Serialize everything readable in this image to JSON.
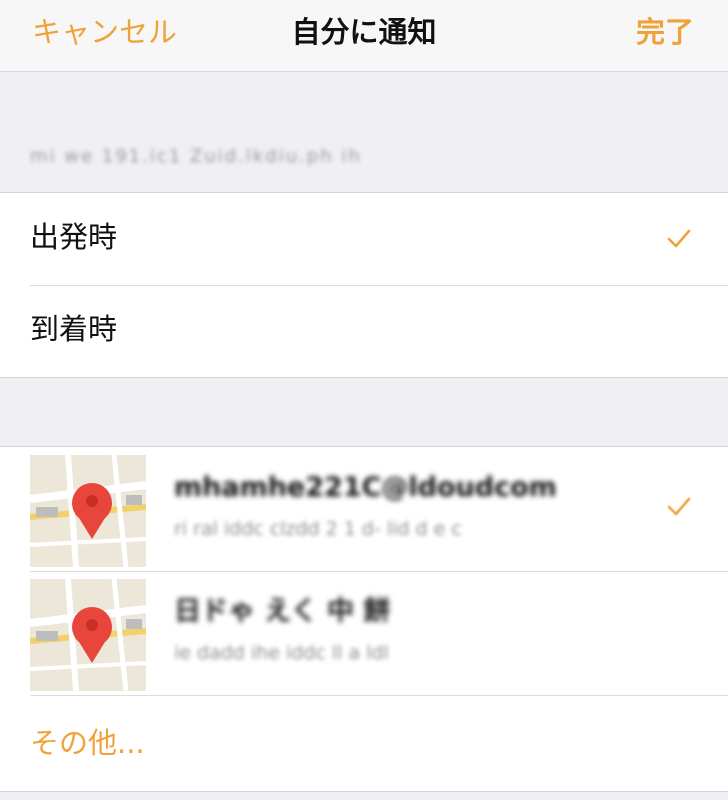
{
  "navbar": {
    "cancel_label": "キャンセル",
    "title": "自分に通知",
    "done_label": "完了"
  },
  "section_header": {
    "note": "mi  we  191.ic1  Zuid.lkdiu.ph  ih"
  },
  "timing_options": [
    {
      "label": "出発時",
      "checked": true
    },
    {
      "label": "到着時",
      "checked": false
    }
  ],
  "locations": [
    {
      "title": "mhamhe221C@ldoudcom",
      "subtitle": "ri  ral  iddc  clzdd  2 1  d-  lid  d  e  c",
      "checked": true,
      "icon": "map-pin-icon"
    },
    {
      "title": "日ドゃ えく 中 餅",
      "subtitle": "ie  dadd  ihe  iddc  ll  a  ldl",
      "checked": false,
      "icon": "map-pin-icon"
    }
  ],
  "more": {
    "label": "その他..."
  },
  "colors": {
    "accent": "#f0a23a",
    "background": "#efeff4",
    "cell": "#ffffff",
    "pin": "#e8453c"
  }
}
